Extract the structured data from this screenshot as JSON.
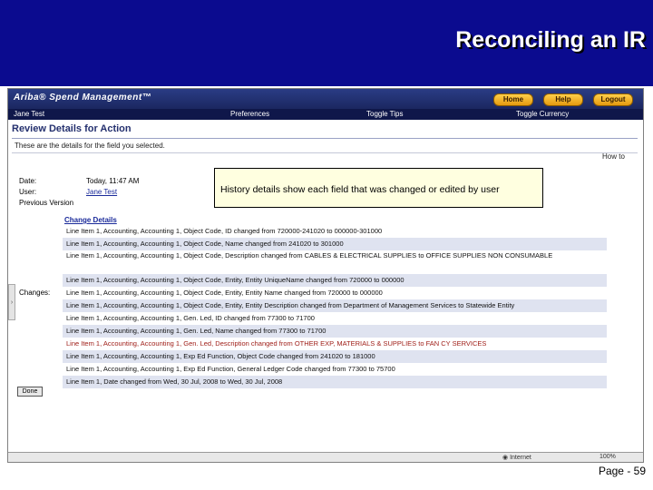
{
  "slide": {
    "title": "Reconciling an IR",
    "page_number": "Page - 59"
  },
  "app": {
    "brand": "Ariba® Spend Management™",
    "buttons": {
      "home": "Home",
      "help": "Help",
      "logout": "Logout"
    },
    "menu": {
      "user": "Jane Test",
      "preferences": "Preferences",
      "toggle_tips": "Toggle Tips",
      "toggle_currency": "Toggle Currency"
    }
  },
  "page": {
    "heading": "Review Details for Action",
    "instruction": "These are the details for the field you selected.",
    "how_to": "How to"
  },
  "fields": {
    "date_label": "Date:",
    "date_value": "Today, 11:47 AM",
    "user_label": "User:",
    "user_value": "Jane Test",
    "prev_version_label": "Previous Version",
    "changes_label": "Changes:"
  },
  "callout": {
    "text": "History details show each field that was changed or edited by user"
  },
  "changes": {
    "heading": "Change Details",
    "rows": [
      "Line Item 1, Accounting, Accounting 1, Object Code, ID changed from 720000-241020 to 000000-301000",
      "Line Item 1, Accounting, Accounting 1, Object Code, Name changed from 241020 to 301000",
      "Line Item 1, Accounting, Accounting 1, Object Code, Description changed from CABLES & ELECTRICAL SUPPLIES to OFFICE SUPPLIES NON CONSUMABLE",
      "Line Item 1, Accounting, Accounting 1, Object Code, Entity, Entity UniqueName changed from 720000 to 000000",
      "Line Item 1, Accounting, Accounting 1, Object Code, Entity, Entity Name changed from 720000 to 000000",
      "Line Item 1, Accounting, Accounting 1, Object Code, Entity, Entity Description changed from Department of Management Services to Statewide Entity",
      "Line Item 1, Accounting, Accounting 1, Gen. Led, ID changed from 77300 to 71700",
      "Line Item 1, Accounting, Accounting 1, Gen. Led, Name changed from 77300 to 71700",
      "Line Item 1, Accounting, Accounting 1, Gen. Led, Description changed from OTHER EXP, MATERIALS & SUPPLIES to FAN CY SERVICES",
      "Line Item 1, Accounting, Accounting 1, Exp Ed Function, Object Code changed from 241020 to 181000",
      "Line Item 1, Accounting, Accounting 1, Exp Ed Function, General Ledger Code changed from 77300 to 75700",
      "Line Item 1, Date changed from Wed, 30 Jul, 2008 to Wed, 30 Jul, 2008"
    ]
  },
  "done_button": "Done",
  "status": {
    "internet": "Internet",
    "zoom": "100%"
  }
}
